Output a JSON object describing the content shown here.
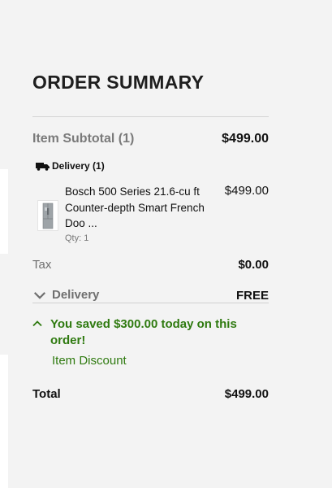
{
  "summary": {
    "title": "ORDER SUMMARY",
    "subtotal_label": "Item Subtotal (1)",
    "subtotal_value": "$499.00",
    "delivery_group_label": "Delivery (1)",
    "item": {
      "name": "Bosch 500 Series 21.6-cu ft Counter-depth Smart French Doo ...",
      "price": "$499.00",
      "qty": "Qty: 1"
    },
    "tax_label": "Tax",
    "tax_value": "$0.00",
    "delivery_label": "Delivery",
    "delivery_value": "FREE",
    "savings_text": "You saved $300.00 today on this order!",
    "discount_label": "Item Discount",
    "total_label": "Total",
    "total_value": "$499.00"
  },
  "colors": {
    "savings_green": "#2f7a10",
    "background": "#f3f3f3"
  },
  "icons": {
    "truck": "truck-icon",
    "delivery_toggle": "chevron-down-icon",
    "savings_toggle": "chevron-up-icon",
    "product": "refrigerator-thumbnail"
  }
}
